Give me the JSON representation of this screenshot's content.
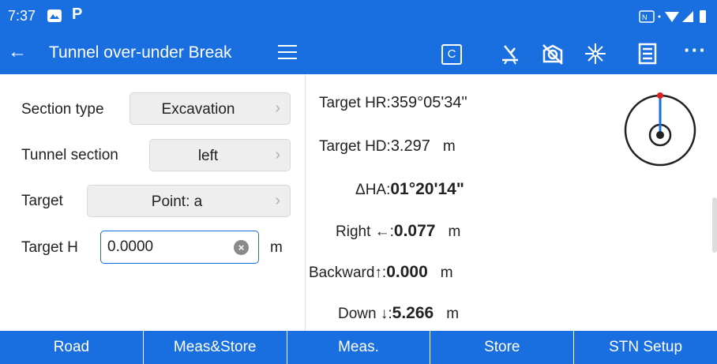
{
  "status_bar": {
    "time": "7:37",
    "left_icons": [
      "gallery-icon",
      "parking-icon"
    ],
    "right_icons": [
      "nfc-icon",
      "wifi-icon",
      "signal-icon",
      "battery-icon"
    ]
  },
  "app_bar": {
    "title": "Tunnel over-under Break",
    "c_button_label": "C",
    "icons": [
      "back-arrow-icon",
      "menu-icon",
      "prism-pole-icon",
      "target-off-icon",
      "laser-icon",
      "list-icon",
      "more-icon"
    ]
  },
  "form": {
    "section_type": {
      "label": "Section type",
      "value": "Excavation"
    },
    "tunnel_section": {
      "label": "Tunnel section",
      "value": "left"
    },
    "target": {
      "label": "Target",
      "value": "Point: a"
    },
    "target_h": {
      "label": "Target H",
      "value": "0.0000",
      "unit": "m"
    }
  },
  "stats": {
    "target_hr": {
      "label": "Target HR:",
      "value": "359°05'34\""
    },
    "target_hd": {
      "label": "Target HD:",
      "value": "3.297",
      "unit": "m"
    },
    "delta_ha": {
      "label": "ΔHA:",
      "value": "01°20'14\""
    },
    "right": {
      "label": "Right ←:",
      "value": "0.077",
      "unit": "m"
    },
    "backward": {
      "label": "Backward↑:",
      "value": "0.000",
      "unit": "m"
    },
    "down": {
      "label": "Down ↓:",
      "value": "5.266",
      "unit": "m"
    }
  },
  "bottom_tabs": [
    "Road",
    "Meas&Store",
    "Meas.",
    "Store",
    "STN Setup"
  ],
  "colors": {
    "primary": "#1a6fe0",
    "compass_needle": "#1a6fe0",
    "compass_north": "#e02020"
  }
}
